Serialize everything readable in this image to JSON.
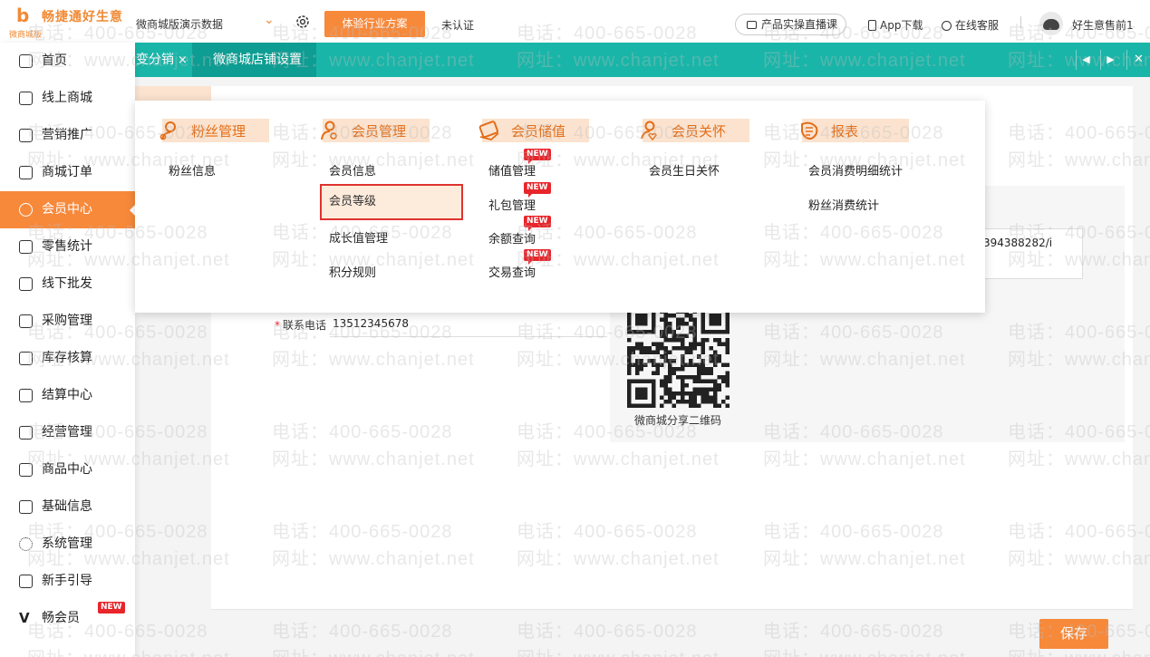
{
  "brand": {
    "name": "畅捷通好生意",
    "sub": "微商城版",
    "mark": "b"
  },
  "header": {
    "account": "微商城版演示数据",
    "trial_button": "体验行业方案",
    "auth_status": "未认证",
    "live_button": "产品实操直播课",
    "app_download": "App下载",
    "support": "在线客服",
    "username": "好生意售前1"
  },
  "tabs": [
    {
      "label": "变分销",
      "close": "×"
    },
    {
      "label": "微商城店铺设置",
      "close": "×"
    }
  ],
  "tab_controls": [
    "◀",
    "▶",
    "✕"
  ],
  "sidebar": {
    "items": [
      {
        "label": "首页",
        "icon": "home-icon"
      },
      {
        "label": "线上商城",
        "icon": "store-icon"
      },
      {
        "label": "营销推广",
        "icon": "promotion-icon"
      },
      {
        "label": "商城订单",
        "icon": "order-icon"
      },
      {
        "label": "会员中心",
        "icon": "member-icon",
        "active": true
      },
      {
        "label": "零售统计",
        "icon": "retail-icon"
      },
      {
        "label": "线下批发",
        "icon": "wholesale-icon"
      },
      {
        "label": "采购管理",
        "icon": "purchase-icon"
      },
      {
        "label": "库存核算",
        "icon": "inventory-icon"
      },
      {
        "label": "结算中心",
        "icon": "settlement-icon"
      },
      {
        "label": "经营管理",
        "icon": "business-icon"
      },
      {
        "label": "商品中心",
        "icon": "product-icon"
      },
      {
        "label": "基础信息",
        "icon": "basic-info-icon"
      },
      {
        "label": "系统管理",
        "icon": "system-icon"
      },
      {
        "label": "新手引导",
        "icon": "guide-icon"
      },
      {
        "label": "畅会员",
        "icon": "vip-icon"
      }
    ],
    "new_badge": "NEW"
  },
  "menu": {
    "columns": [
      {
        "title": "粉丝管理",
        "items": [
          "粉丝信息"
        ]
      },
      {
        "title": "会员管理",
        "items": [
          "会员信息",
          "会员等级",
          "成长值管理",
          "积分规则"
        ]
      },
      {
        "title": "会员储值",
        "items": [
          "储值管理",
          "礼包管理",
          "余额查询",
          "交易查询"
        ]
      },
      {
        "title": "会员关怀",
        "items": [
          "会员生日关怀"
        ]
      },
      {
        "title": "报表",
        "items": [
          "会员消费明细统计",
          "粉丝消费统计"
        ]
      }
    ],
    "new_badge": "NEW"
  },
  "form": {
    "phone_label": "联系电话",
    "required_mark": "*",
    "phone_value": "13512345678",
    "url_fragment": "394388282/i",
    "qr_caption": "微商城分享二维码"
  },
  "save_button": "保存",
  "watermark": {
    "phone": "电话：400-665-0028",
    "site": "网址：www.chanjet.net"
  },
  "colors": {
    "accent": "#f7893b",
    "teal": "#19b5a8",
    "teal_dark": "#0e9d92",
    "new_red": "#e8252b"
  }
}
